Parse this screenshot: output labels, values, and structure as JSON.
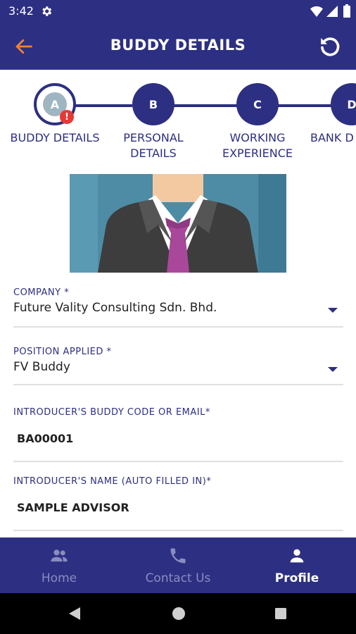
{
  "status_bar": {
    "time": "3:42"
  },
  "app_bar": {
    "title": "BUDDY DETAILS"
  },
  "stepper": {
    "steps": [
      {
        "letter": "A",
        "label_line1": "BUDDY DETAILS",
        "label_line2": "",
        "badge": "!"
      },
      {
        "letter": "B",
        "label_line1": "PERSONAL",
        "label_line2": "DETAILS"
      },
      {
        "letter": "C",
        "label_line1": "WORKING",
        "label_line2": "EXPERIENCE"
      },
      {
        "letter": "D",
        "label_line1": "BANK D",
        "label_line2": ""
      }
    ]
  },
  "form": {
    "company": {
      "label": "COMPANY *",
      "value": "Future Vality Consulting Sdn. Bhd."
    },
    "position": {
      "label": "POSITION APPLIED *",
      "value": "FV Buddy"
    },
    "introducer_code": {
      "label": "INTRODUCER'S BUDDY CODE OR EMAIL*",
      "value": "BA00001"
    },
    "introducer_name": {
      "label": "INTRODUCER'S NAME (AUTO FILLED IN)*",
      "value": "SAMPLE ADVISOR"
    }
  },
  "bottom_nav": {
    "items": [
      {
        "label": "Home",
        "icon": "people-icon",
        "active": false
      },
      {
        "label": "Contact Us",
        "icon": "phone-icon",
        "active": false
      },
      {
        "label": "Profile",
        "icon": "person-icon",
        "active": true
      }
    ]
  },
  "colors": {
    "primary": "#2d2f82",
    "accent": "#e8833a",
    "badge": "#e53935",
    "inactive_nav": "#8a8cc0"
  }
}
